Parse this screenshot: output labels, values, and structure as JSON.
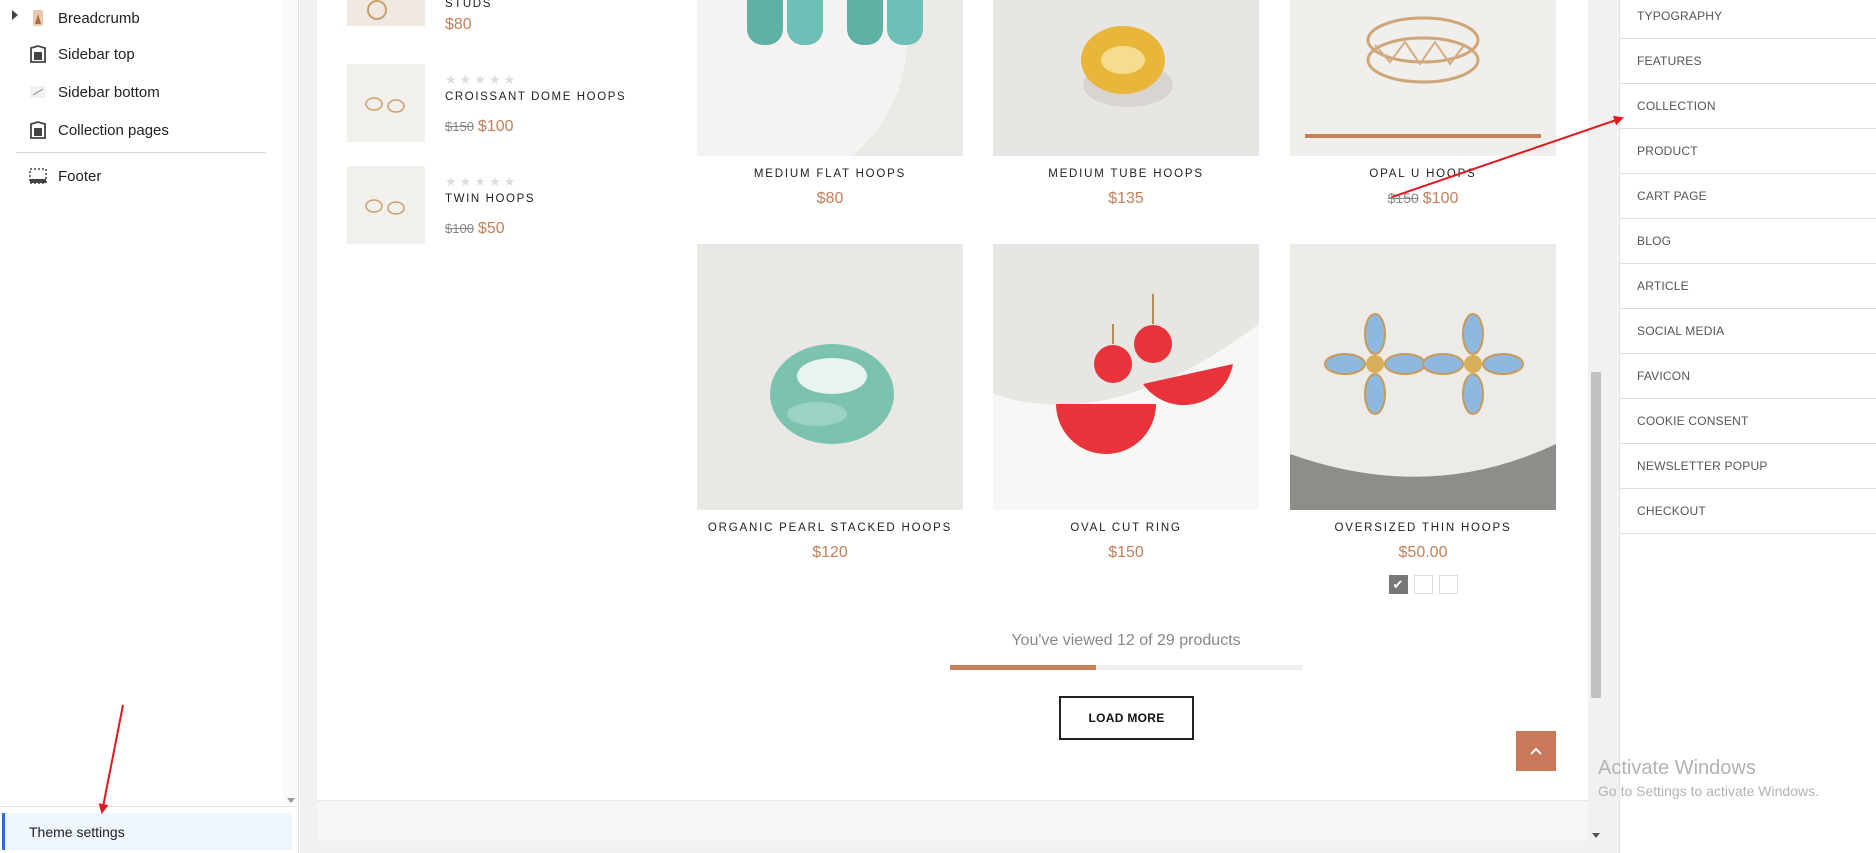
{
  "left_panel": {
    "items": [
      {
        "label": "Breadcrumb",
        "icon": "breadcrumb-image-icon"
      },
      {
        "label": "Sidebar top",
        "icon": "section-tag-icon"
      },
      {
        "label": "Sidebar bottom",
        "icon": "divider-line-icon"
      },
      {
        "label": "Collection pages",
        "icon": "section-tag-icon"
      }
    ],
    "footer_item": {
      "label": "Footer",
      "icon": "footer-layout-icon"
    },
    "theme_settings": "Theme settings"
  },
  "sidebar_products": [
    {
      "name": "STUDS",
      "price": "$80",
      "old_price": ""
    },
    {
      "name": "CROISSANT DOME HOOPS",
      "price": "$100",
      "old_price": "$150",
      "stars": "★★★★★"
    },
    {
      "name": "TWIN HOOPS",
      "price": "$50",
      "old_price": "$100",
      "stars": "★★★★★"
    }
  ],
  "products": [
    {
      "name": "MEDIUM FLAT HOOPS",
      "price": "$80",
      "old_price": ""
    },
    {
      "name": "MEDIUM TUBE HOOPS",
      "price": "$135",
      "old_price": ""
    },
    {
      "name": "OPAL U HOOPS",
      "price": "$100",
      "old_price": "$150"
    },
    {
      "name": "ORGANIC PEARL STACKED HOOPS",
      "price": "$120",
      "old_price": ""
    },
    {
      "name": "OVAL CUT RING",
      "price": "$150",
      "old_price": ""
    },
    {
      "name": "OVERSIZED THIN HOOPS",
      "price": "$50.00",
      "old_price": ""
    }
  ],
  "pagination": {
    "viewed_text": "You've viewed 12 of 29 products",
    "viewed": 12,
    "total": 29,
    "load_more": "LOAD MORE"
  },
  "settings_menu": [
    "TYPOGRAPHY",
    "FEATURES",
    "COLLECTION",
    "PRODUCT",
    "CART PAGE",
    "BLOG",
    "ARTICLE",
    "SOCIAL MEDIA",
    "FAVICON",
    "COOKIE CONSENT",
    "NEWSLETTER POPUP",
    "CHECKOUT"
  ],
  "watermark": {
    "title": "Activate Windows",
    "subtitle": "Go to Settings to activate Windows."
  },
  "colors": {
    "accent": "#c3805a",
    "annotation_arrow": "#e0191e",
    "selection": "#2c6ecb"
  }
}
